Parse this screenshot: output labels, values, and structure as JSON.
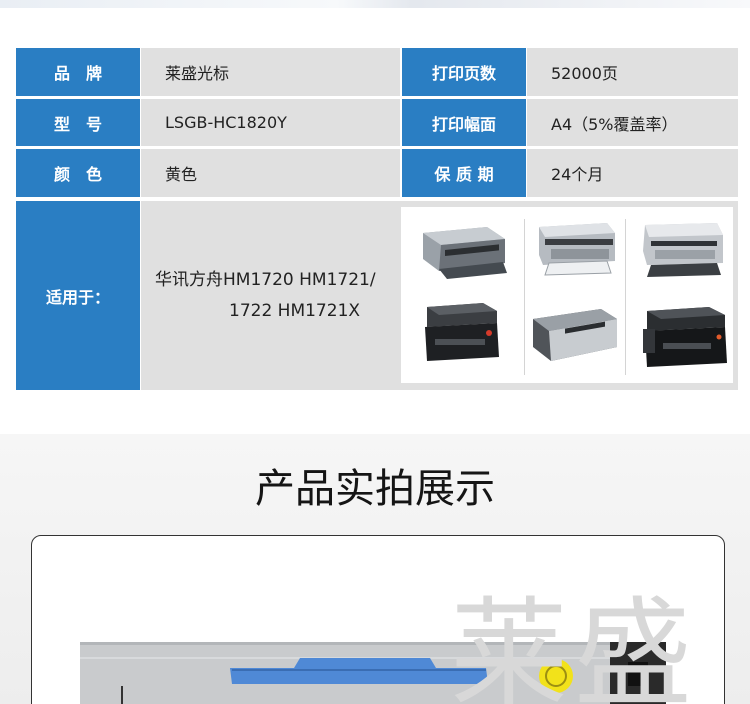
{
  "specs": {
    "brand_label": "品　牌",
    "brand_value": "莱盛光标",
    "pages_label": "打印页数",
    "pages_value": "52000页",
    "model_label": "型　号",
    "model_value": "LSGB-HC1820Y",
    "format_label": "打印幅面",
    "format_value": "A4（5%覆盖率）",
    "color_label": "颜　色",
    "color_value": "黄色",
    "warranty_label": "保 质 期",
    "warranty_value": "24个月",
    "compat_label": "适用于：",
    "compat_line1": "华讯方舟HM1720 HM1721/",
    "compat_line2": "1722 HM1721X"
  },
  "gallery": {
    "title": "产品实拍展示",
    "watermark": "莱盛"
  },
  "colors": {
    "label_bg": "#2a7ec3",
    "value_bg": "#e0e0e0",
    "handle_blue": "#4f89d6",
    "indicator_yellow": "#f2e21a"
  }
}
